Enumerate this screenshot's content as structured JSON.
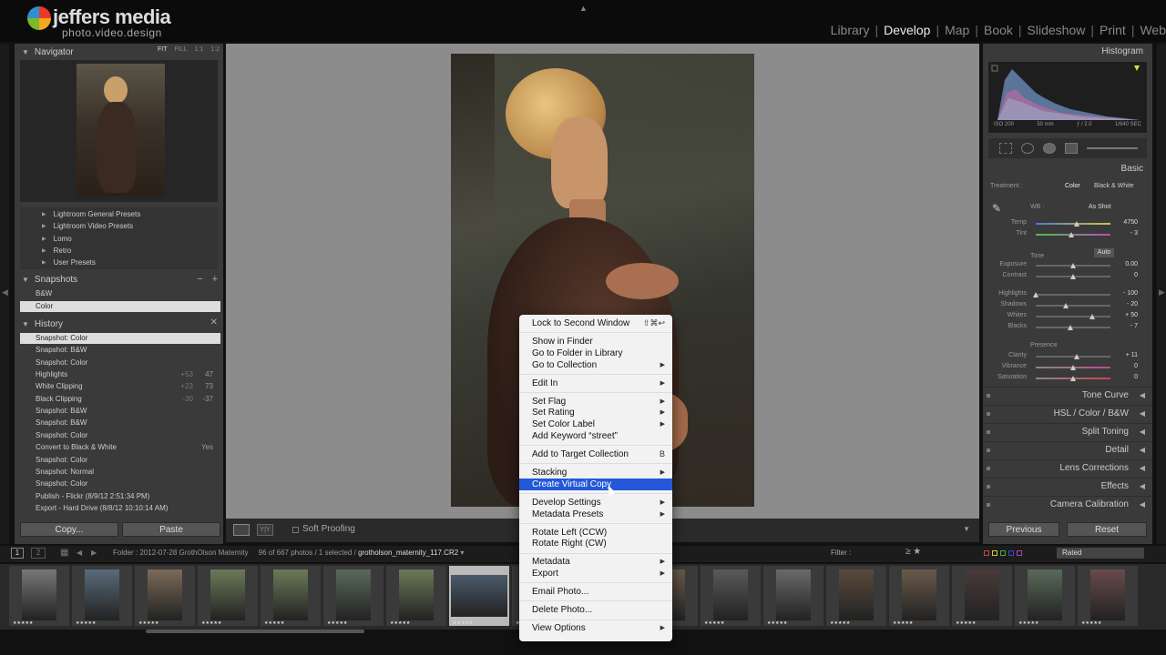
{
  "logo": {
    "title": "jeffers media",
    "subtitle": "photo.video.design"
  },
  "modules": [
    {
      "label": "Library",
      "active": false
    },
    {
      "label": "Develop",
      "active": true
    },
    {
      "label": "Map",
      "active": false
    },
    {
      "label": "Book",
      "active": false
    },
    {
      "label": "Slideshow",
      "active": false
    },
    {
      "label": "Print",
      "active": false
    },
    {
      "label": "Web",
      "active": false
    }
  ],
  "left_panel": {
    "navigator": {
      "title": "Navigator",
      "modes": [
        "FIT",
        "FILL",
        "1:1",
        "1:2"
      ]
    },
    "presets": [
      "Lightroom General Presets",
      "Lightroom Video Presets",
      "Lomo",
      "Retro",
      "User Presets"
    ],
    "snapshots": {
      "title": "Snapshots",
      "items": [
        "B&W",
        "Color"
      ],
      "selected": "Color"
    },
    "history": {
      "title": "History",
      "items": [
        {
          "label": "Snapshot: Color",
          "v1": "",
          "v2": ""
        },
        {
          "label": "Snapshot: B&W",
          "v1": "",
          "v2": ""
        },
        {
          "label": "Snapshot: Color",
          "v1": "",
          "v2": ""
        },
        {
          "label": "Highlights",
          "v1": "+53",
          "v2": "47"
        },
        {
          "label": "White Clipping",
          "v1": "+23",
          "v2": "73"
        },
        {
          "label": "Black Clipping",
          "v1": "-30",
          "v2": "-37"
        },
        {
          "label": "Snapshot: B&W",
          "v1": "",
          "v2": ""
        },
        {
          "label": "Snapshot: B&W",
          "v1": "",
          "v2": ""
        },
        {
          "label": "Snapshot: Color",
          "v1": "",
          "v2": ""
        },
        {
          "label": "Convert to Black & White",
          "v1": "",
          "v2": "Yes"
        },
        {
          "label": "Snapshot: Color",
          "v1": "",
          "v2": ""
        },
        {
          "label": "Snapshot: Normal",
          "v1": "",
          "v2": ""
        },
        {
          "label": "Snapshot: Color",
          "v1": "",
          "v2": ""
        },
        {
          "label": "Publish - Flickr (8/9/12 2:51:34 PM)",
          "v1": "",
          "v2": ""
        },
        {
          "label": "Export - Hard Drive (8/8/12 10:10:14 AM)",
          "v1": "",
          "v2": ""
        }
      ]
    },
    "buttons": {
      "copy": "Copy...",
      "paste": "Paste"
    }
  },
  "toolbar": {
    "soft_proofing": "Soft Proofing"
  },
  "right_panel": {
    "histogram_title": "Histogram",
    "info": [
      "ISO 200",
      "50 mm",
      "ƒ / 2.0",
      "1/640 SEC"
    ],
    "basic_title": "Basic",
    "treatment": {
      "label": "Treatment :",
      "color": "Color",
      "bw": "Black & White"
    },
    "wb": {
      "label": "WB :",
      "value": "As Shot"
    },
    "sliders": [
      {
        "name": "Temp",
        "value": "4750",
        "pos": 0.55
      },
      {
        "name": "Tint",
        "value": "- 3",
        "pos": 0.48
      },
      {
        "name": "Exposure",
        "value": "0.00",
        "pos": 0.5
      },
      {
        "name": "Contrast",
        "value": "0",
        "pos": 0.5
      },
      {
        "name": "Highlights",
        "value": "- 100",
        "pos": 0.0
      },
      {
        "name": "Shadows",
        "value": "- 20",
        "pos": 0.4
      },
      {
        "name": "Whites",
        "value": "+ 50",
        "pos": 0.75
      },
      {
        "name": "Blacks",
        "value": "- 7",
        "pos": 0.46
      },
      {
        "name": "Clarity",
        "value": "+ 11",
        "pos": 0.55
      },
      {
        "name": "Vibrance",
        "value": "0",
        "pos": 0.5
      },
      {
        "name": "Saturation",
        "value": "0",
        "pos": 0.5
      }
    ],
    "tone_label": "Tone",
    "auto_label": "Auto",
    "presence_label": "Presence",
    "panels": [
      "Tone Curve",
      "HSL / Color / B&W",
      "Split Toning",
      "Detail",
      "Lens Corrections",
      "Effects",
      "Camera Calibration"
    ],
    "buttons": {
      "previous": "Previous",
      "reset": "Reset"
    }
  },
  "filmbar": {
    "pages": [
      "1",
      "2"
    ],
    "folder": "Folder : 2012-07-28 GrothOlson Maternity",
    "count": "96 of 667 photos / 1 selected /",
    "file": "grotholson_maternity_117.CR2",
    "filter_label": "Filter :",
    "rated": "Rated"
  },
  "context_menu": [
    {
      "label": "Lock to Second Window",
      "shortcut": "⇧⌘↩",
      "arrow": false
    },
    {
      "divider": true
    },
    {
      "label": "Show in Finder",
      "arrow": false
    },
    {
      "label": "Go to Folder in Library",
      "arrow": false
    },
    {
      "label": "Go to Collection",
      "arrow": true
    },
    {
      "divider": true
    },
    {
      "label": "Edit In",
      "arrow": true
    },
    {
      "divider": true
    },
    {
      "label": "Set Flag",
      "arrow": true
    },
    {
      "label": "Set Rating",
      "arrow": true
    },
    {
      "label": "Set Color Label",
      "arrow": true
    },
    {
      "label": "Add Keyword “street”",
      "arrow": false
    },
    {
      "divider": true
    },
    {
      "label": "Add to Target Collection",
      "shortcut": "B",
      "arrow": false
    },
    {
      "divider": true
    },
    {
      "label": "Stacking",
      "arrow": true
    },
    {
      "label": "Create Virtual Copy",
      "arrow": false,
      "highlighted": true
    },
    {
      "divider": true
    },
    {
      "label": "Develop Settings",
      "arrow": true
    },
    {
      "label": "Metadata Presets",
      "arrow": true
    },
    {
      "divider": true
    },
    {
      "label": "Rotate Left (CCW)",
      "arrow": false
    },
    {
      "label": "Rotate Right (CW)",
      "arrow": false
    },
    {
      "divider": true
    },
    {
      "label": "Metadata",
      "arrow": true
    },
    {
      "label": "Export",
      "arrow": true
    },
    {
      "divider": true
    },
    {
      "label": "Email Photo...",
      "arrow": false
    },
    {
      "divider": true
    },
    {
      "label": "Delete Photo...",
      "arrow": false
    },
    {
      "divider": true
    },
    {
      "label": "View Options",
      "arrow": true
    }
  ],
  "colors": {
    "accent": "#2458d8",
    "panel": "#3a3a3a",
    "canvas": "#8c8c8c"
  }
}
